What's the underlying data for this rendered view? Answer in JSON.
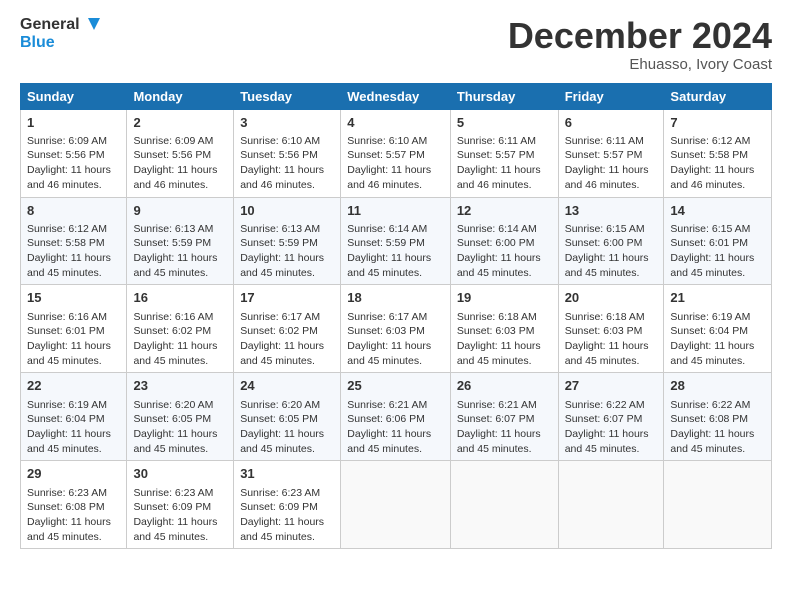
{
  "header": {
    "logo_line1": "General",
    "logo_line2": "Blue",
    "month": "December 2024",
    "location": "Ehuasso, Ivory Coast"
  },
  "days_of_week": [
    "Sunday",
    "Monday",
    "Tuesday",
    "Wednesday",
    "Thursday",
    "Friday",
    "Saturday"
  ],
  "weeks": [
    [
      {
        "day": "1",
        "sunrise": "6:09 AM",
        "sunset": "5:56 PM",
        "daylight": "11 hours and 46 minutes."
      },
      {
        "day": "2",
        "sunrise": "6:09 AM",
        "sunset": "5:56 PM",
        "daylight": "11 hours and 46 minutes."
      },
      {
        "day": "3",
        "sunrise": "6:10 AM",
        "sunset": "5:56 PM",
        "daylight": "11 hours and 46 minutes."
      },
      {
        "day": "4",
        "sunrise": "6:10 AM",
        "sunset": "5:57 PM",
        "daylight": "11 hours and 46 minutes."
      },
      {
        "day": "5",
        "sunrise": "6:11 AM",
        "sunset": "5:57 PM",
        "daylight": "11 hours and 46 minutes."
      },
      {
        "day": "6",
        "sunrise": "6:11 AM",
        "sunset": "5:57 PM",
        "daylight": "11 hours and 46 minutes."
      },
      {
        "day": "7",
        "sunrise": "6:12 AM",
        "sunset": "5:58 PM",
        "daylight": "11 hours and 46 minutes."
      }
    ],
    [
      {
        "day": "8",
        "sunrise": "6:12 AM",
        "sunset": "5:58 PM",
        "daylight": "11 hours and 45 minutes."
      },
      {
        "day": "9",
        "sunrise": "6:13 AM",
        "sunset": "5:59 PM",
        "daylight": "11 hours and 45 minutes."
      },
      {
        "day": "10",
        "sunrise": "6:13 AM",
        "sunset": "5:59 PM",
        "daylight": "11 hours and 45 minutes."
      },
      {
        "day": "11",
        "sunrise": "6:14 AM",
        "sunset": "5:59 PM",
        "daylight": "11 hours and 45 minutes."
      },
      {
        "day": "12",
        "sunrise": "6:14 AM",
        "sunset": "6:00 PM",
        "daylight": "11 hours and 45 minutes."
      },
      {
        "day": "13",
        "sunrise": "6:15 AM",
        "sunset": "6:00 PM",
        "daylight": "11 hours and 45 minutes."
      },
      {
        "day": "14",
        "sunrise": "6:15 AM",
        "sunset": "6:01 PM",
        "daylight": "11 hours and 45 minutes."
      }
    ],
    [
      {
        "day": "15",
        "sunrise": "6:16 AM",
        "sunset": "6:01 PM",
        "daylight": "11 hours and 45 minutes."
      },
      {
        "day": "16",
        "sunrise": "6:16 AM",
        "sunset": "6:02 PM",
        "daylight": "11 hours and 45 minutes."
      },
      {
        "day": "17",
        "sunrise": "6:17 AM",
        "sunset": "6:02 PM",
        "daylight": "11 hours and 45 minutes."
      },
      {
        "day": "18",
        "sunrise": "6:17 AM",
        "sunset": "6:03 PM",
        "daylight": "11 hours and 45 minutes."
      },
      {
        "day": "19",
        "sunrise": "6:18 AM",
        "sunset": "6:03 PM",
        "daylight": "11 hours and 45 minutes."
      },
      {
        "day": "20",
        "sunrise": "6:18 AM",
        "sunset": "6:03 PM",
        "daylight": "11 hours and 45 minutes."
      },
      {
        "day": "21",
        "sunrise": "6:19 AM",
        "sunset": "6:04 PM",
        "daylight": "11 hours and 45 minutes."
      }
    ],
    [
      {
        "day": "22",
        "sunrise": "6:19 AM",
        "sunset": "6:04 PM",
        "daylight": "11 hours and 45 minutes."
      },
      {
        "day": "23",
        "sunrise": "6:20 AM",
        "sunset": "6:05 PM",
        "daylight": "11 hours and 45 minutes."
      },
      {
        "day": "24",
        "sunrise": "6:20 AM",
        "sunset": "6:05 PM",
        "daylight": "11 hours and 45 minutes."
      },
      {
        "day": "25",
        "sunrise": "6:21 AM",
        "sunset": "6:06 PM",
        "daylight": "11 hours and 45 minutes."
      },
      {
        "day": "26",
        "sunrise": "6:21 AM",
        "sunset": "6:07 PM",
        "daylight": "11 hours and 45 minutes."
      },
      {
        "day": "27",
        "sunrise": "6:22 AM",
        "sunset": "6:07 PM",
        "daylight": "11 hours and 45 minutes."
      },
      {
        "day": "28",
        "sunrise": "6:22 AM",
        "sunset": "6:08 PM",
        "daylight": "11 hours and 45 minutes."
      }
    ],
    [
      {
        "day": "29",
        "sunrise": "6:23 AM",
        "sunset": "6:08 PM",
        "daylight": "11 hours and 45 minutes."
      },
      {
        "day": "30",
        "sunrise": "6:23 AM",
        "sunset": "6:09 PM",
        "daylight": "11 hours and 45 minutes."
      },
      {
        "day": "31",
        "sunrise": "6:23 AM",
        "sunset": "6:09 PM",
        "daylight": "11 hours and 45 minutes."
      },
      null,
      null,
      null,
      null
    ]
  ],
  "labels": {
    "sunrise": "Sunrise:",
    "sunset": "Sunset:",
    "daylight": "Daylight:"
  }
}
